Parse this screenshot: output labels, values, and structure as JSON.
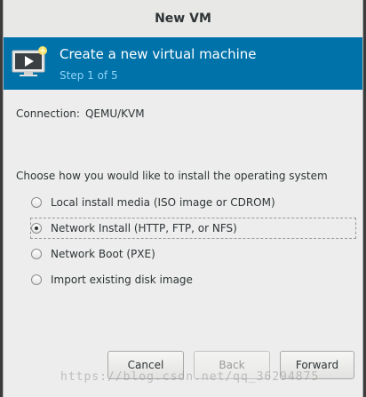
{
  "window": {
    "title": "New VM"
  },
  "banner": {
    "title": "Create a new virtual machine",
    "step": "Step 1 of 5",
    "icon": "virtual-machine-icon"
  },
  "connection": {
    "label": "Connection:",
    "value": "QEMU/KVM"
  },
  "install": {
    "question": "Choose how you would like to install the operating system",
    "selected": "Network Install (HTTP, FTP, or NFS)",
    "options": [
      {
        "label": "Local install media (ISO image or CDROM)"
      },
      {
        "label": "Network Install (HTTP, FTP, or NFS)"
      },
      {
        "label": "Network Boot (PXE)"
      },
      {
        "label": "Import existing disk image"
      }
    ]
  },
  "buttons": {
    "cancel": "Cancel",
    "back": "Back",
    "forward": "Forward"
  },
  "watermark": "https://blog.csdn.net/qq_36294875",
  "colors": {
    "banner": "#0072aa",
    "step_text": "#8fd3f5",
    "background": "#ededed"
  }
}
